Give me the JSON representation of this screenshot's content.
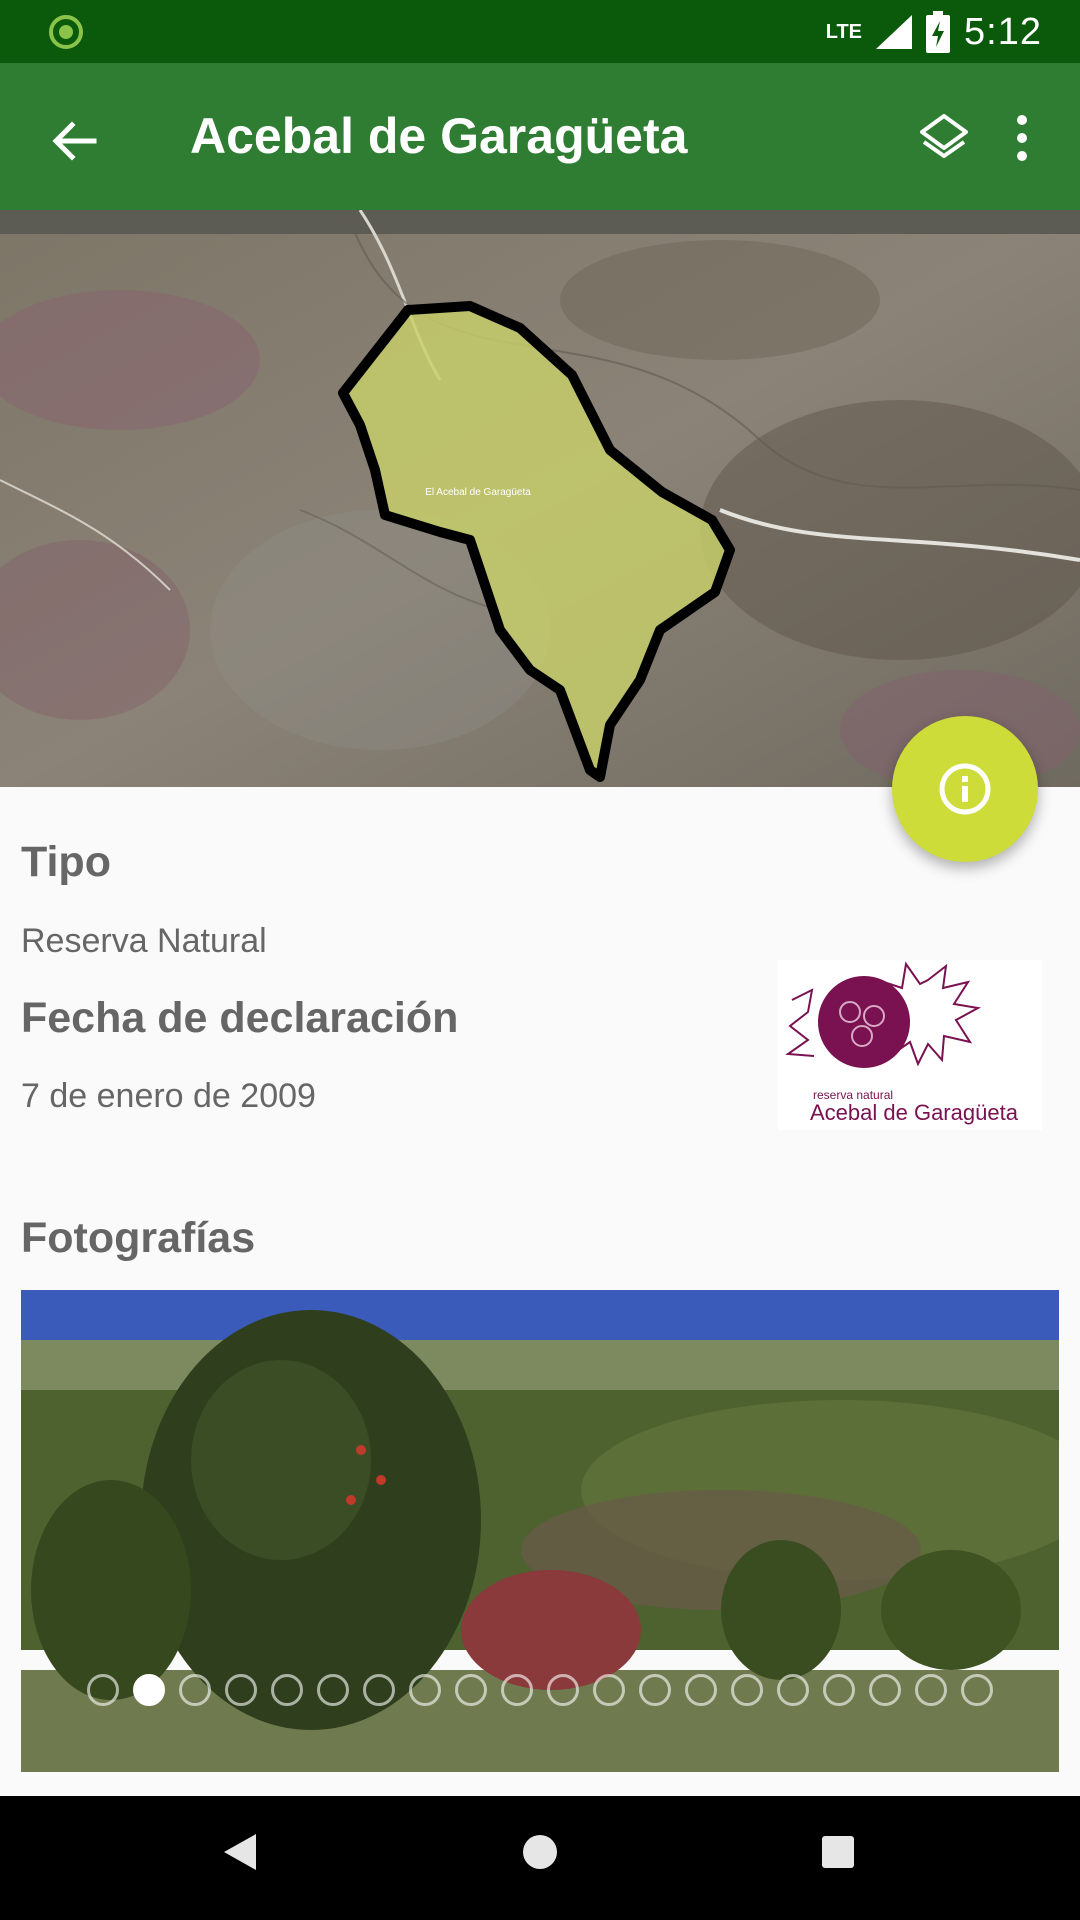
{
  "status_bar": {
    "time": "5:12",
    "network": "LTE"
  },
  "toolbar": {
    "title": "Acebal de Garagüeta"
  },
  "map": {
    "area_label": "El Acebal de Garagüeta",
    "area_fill": "#c8cf6a",
    "outline": "#000000"
  },
  "details": {
    "tipo_heading": "Tipo",
    "tipo_value": "Reserva Natural",
    "fecha_heading": "Fecha de declaración",
    "fecha_value": "7 de enero de 2009"
  },
  "logo": {
    "small_text": "reserva natural",
    "big_text": "Acebal de Garagüeta",
    "color": "#7a1150"
  },
  "photos": {
    "heading": "Fotografías",
    "total": 20,
    "active_index": 1
  },
  "colors": {
    "toolbar": "#2e7d32",
    "status_bar": "#0b5a0b",
    "fab": "#cddc39"
  }
}
